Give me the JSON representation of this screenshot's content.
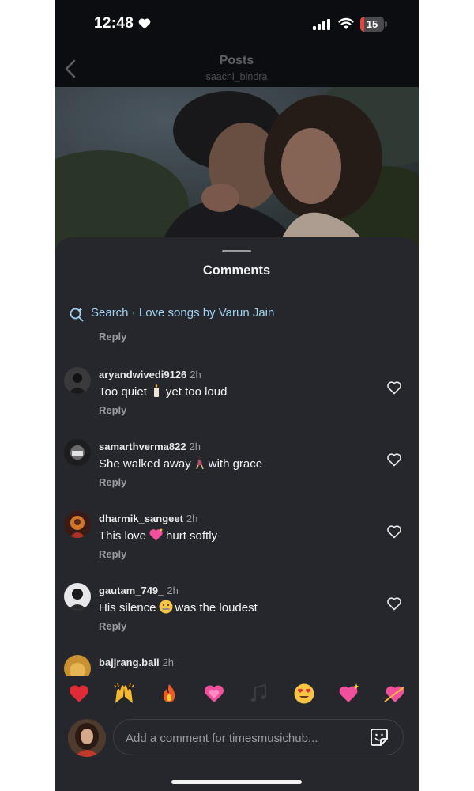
{
  "status_bar": {
    "time": "12:48",
    "battery": "15"
  },
  "header": {
    "title": "Posts",
    "subtitle": "saachi_bindra"
  },
  "sheet": {
    "title": "Comments",
    "search_text": "Search · Love songs by Varun Jain",
    "reply_label": "Reply"
  },
  "comments": [
    {
      "username": "aryandwivedi9126",
      "time": "2h",
      "before": "Too quiet",
      "after": "yet too loud",
      "emoji": "candle-emoji",
      "reply": "Reply"
    },
    {
      "username": "samarthverma822",
      "time": "2h",
      "before": "She walked away",
      "after": "with grace",
      "emoji": "walking-woman-emoji",
      "reply": "Reply"
    },
    {
      "username": "dharmik_sangeet",
      "time": "2h",
      "before": "This love",
      "after": "hurt softly",
      "emoji": "sparkling-heart-emoji",
      "reply": "Reply"
    },
    {
      "username": "gautam_749_",
      "time": "2h",
      "before": "His silence",
      "after": "was the loudest",
      "emoji": "zipper-mouth-emoji",
      "reply": "Reply"
    },
    {
      "username": "bajjrang.bali",
      "time": "2h"
    }
  ],
  "reactions": [
    "red-heart",
    "raising-hands",
    "fire",
    "growing-heart",
    "musical-notes",
    "heart-eyes",
    "sparkling-heart",
    "heart-with-arrow"
  ],
  "composer": {
    "placeholder": "Add a comment for timesmusichub..."
  },
  "colors": {
    "background": "#0c0d10",
    "sheet": "#25272c",
    "link": "#9fd0f0",
    "battery": "#e0463e"
  }
}
